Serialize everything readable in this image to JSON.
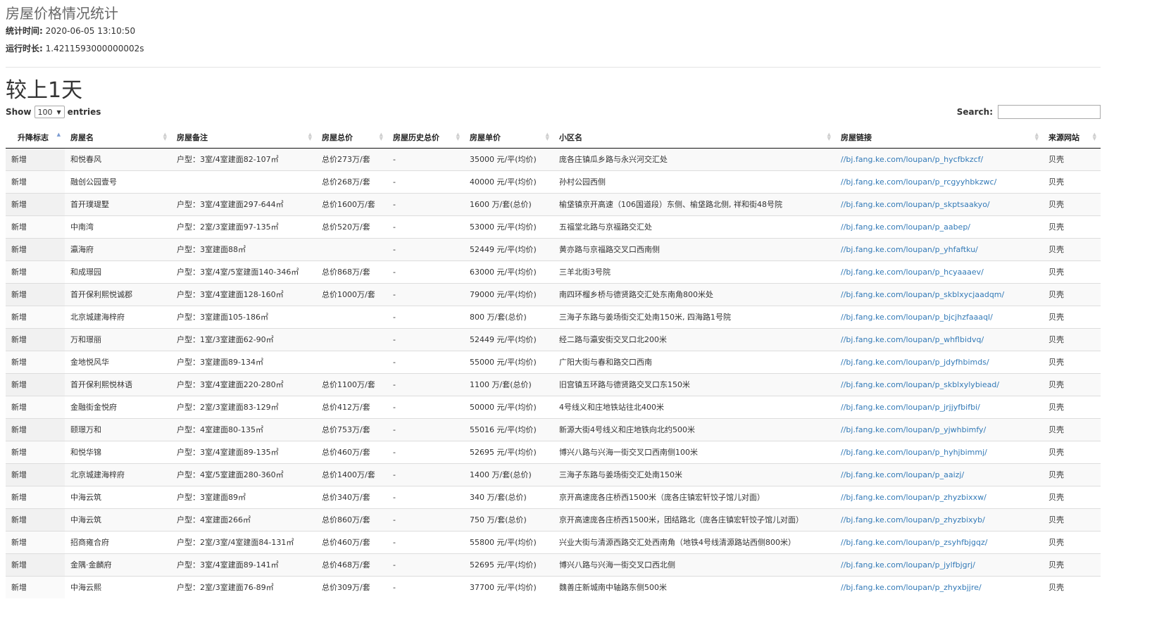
{
  "header": {
    "title": "房屋价格情况统计",
    "stat_time_label": "统计时间:",
    "stat_time_value": "2020-06-05 13:10:50",
    "run_time_label": "运行时长:",
    "run_time_value": "1.4211593000000002s"
  },
  "section": {
    "title": "较上1天"
  },
  "controls": {
    "show_label": "Show",
    "page_size": "100",
    "entries_label": "entries",
    "search_label": "Search:",
    "search_value": ""
  },
  "table": {
    "sorted_column": 0,
    "sort_direction": "asc",
    "columns": [
      "升降标志",
      "房屋名",
      "房屋备注",
      "房屋总价",
      "房屋历史总价",
      "房屋单价",
      "小区名",
      "房屋链接",
      "来源网站"
    ],
    "rows": [
      [
        "新增",
        "和悦春风",
        "户型：3室/4室建面82-107㎡",
        "总价273万/套",
        "-",
        "35000 元/平(均价)",
        "庞各庄镇瓜乡路与永兴河交汇处",
        "//bj.fang.ke.com/loupan/p_hycfbkzcf/",
        "贝壳"
      ],
      [
        "新增",
        "融创公园壹号",
        "",
        "总价268万/套",
        "-",
        "40000 元/平(均价)",
        "孙村公园西侧",
        "//bj.fang.ke.com/loupan/p_rcgyyhbkzwc/",
        "贝壳"
      ],
      [
        "新增",
        "首开璞瑅墅",
        "户型：3室/4室建面297-644㎡",
        "总价1600万/套",
        "-",
        "1600 万/套(总价)",
        "榆垡镇京开高速（106国道段）东侧、榆垡路北侧, 祥和街48号院",
        "//bj.fang.ke.com/loupan/p_skptsaakyo/",
        "贝壳"
      ],
      [
        "新增",
        "中南湾",
        "户型：2室/3室建面97-135㎡",
        "总价520万/套",
        "-",
        "53000 元/平(均价)",
        "五福堂北路与京福路交汇处",
        "//bj.fang.ke.com/loupan/p_aabep/",
        "贝壳"
      ],
      [
        "新增",
        "瀛海府",
        "户型：3室建面88㎡",
        "",
        "-",
        "52449 元/平(均价)",
        "黄亦路与京福路交叉口西南侧",
        "//bj.fang.ke.com/loupan/p_yhfaftku/",
        "贝壳"
      ],
      [
        "新增",
        "和成璟园",
        "户型：3室/4室/5室建面140-346㎡",
        "总价868万/套",
        "-",
        "63000 元/平(均价)",
        "三羊北街3号院",
        "//bj.fang.ke.com/loupan/p_hcyaaaev/",
        "贝壳"
      ],
      [
        "新增",
        "首开保利熙悦诚郡",
        "户型：3室/4室建面128-160㎡",
        "总价1000万/套",
        "-",
        "79000 元/平(均价)",
        "南四环榴乡桥与德贤路交汇处东南角800米处",
        "//bj.fang.ke.com/loupan/p_skblxycjaadqm/",
        "贝壳"
      ],
      [
        "新增",
        "北京城建海梓府",
        "户型：3室建面105-186㎡",
        "",
        "-",
        "800 万/套(总价)",
        "三海子东路与姜场街交汇处南150米, 四海路1号院",
        "//bj.fang.ke.com/loupan/p_bjcjhzfaaaql/",
        "贝壳"
      ],
      [
        "新增",
        "万和璟丽",
        "户型：1室/3室建面62-90㎡",
        "",
        "-",
        "52449 元/平(均价)",
        "经二路与瀛安街交叉口北200米",
        "//bj.fang.ke.com/loupan/p_whflbidvq/",
        "贝壳"
      ],
      [
        "新增",
        "金地悦风华",
        "户型：3室建面89-134㎡",
        "",
        "-",
        "55000 元/平(均价)",
        "广阳大街与春和路交口西南",
        "//bj.fang.ke.com/loupan/p_jdyfhbimds/",
        "贝壳"
      ],
      [
        "新增",
        "首开保利熙悦林语",
        "户型：3室/4室建面220-280㎡",
        "总价1100万/套",
        "-",
        "1100 万/套(总价)",
        "旧宫镇五环路与德贤路交叉口东150米",
        "//bj.fang.ke.com/loupan/p_skblxylybiead/",
        "贝壳"
      ],
      [
        "新增",
        "金融街金悦府",
        "户型：2室/3室建面83-129㎡",
        "总价412万/套",
        "-",
        "50000 元/平(均价)",
        "4号线义和庄地铁站往北400米",
        "//bj.fang.ke.com/loupan/p_jrjjyfbifbi/",
        "贝壳"
      ],
      [
        "新增",
        "颐璟万和",
        "户型：4室建面80-135㎡",
        "总价753万/套",
        "-",
        "55016 元/平(均价)",
        "新源大街4号线义和庄地铁向北约500米",
        "//bj.fang.ke.com/loupan/p_yjwhbimfy/",
        "贝壳"
      ],
      [
        "新增",
        "和悦华锦",
        "户型：3室/4室建面89-135㎡",
        "总价460万/套",
        "-",
        "52695 元/平(均价)",
        "博兴八路与兴海一街交叉口西南侧100米",
        "//bj.fang.ke.com/loupan/p_hyhjbimmj/",
        "贝壳"
      ],
      [
        "新增",
        "北京城建海梓府",
        "户型：4室/5室建面280-360㎡",
        "总价1400万/套",
        "-",
        "1400 万/套(总价)",
        "三海子东路与姜场街交汇处南150米",
        "//bj.fang.ke.com/loupan/p_aaizj/",
        "贝壳"
      ],
      [
        "新增",
        "中海云筑",
        "户型：3室建面89㎡",
        "总价340万/套",
        "-",
        "340 万/套(总价)",
        "京开高速庞各庄桥西1500米（庞各庄镇宏轩饺子馆儿对面）",
        "//bj.fang.ke.com/loupan/p_zhyzbixxw/",
        "贝壳"
      ],
      [
        "新增",
        "中海云筑",
        "户型：4室建面266㎡",
        "总价860万/套",
        "-",
        "750 万/套(总价)",
        "京开高速庞各庄桥西1500米，团结路北（庞各庄镇宏轩饺子馆儿对面）",
        "//bj.fang.ke.com/loupan/p_zhyzbixyb/",
        "贝壳"
      ],
      [
        "新增",
        "招商雍合府",
        "户型：2室/3室/4室建面84-131㎡",
        "总价460万/套",
        "-",
        "55800 元/平(均价)",
        "兴业大街与清源西路交汇处西南角（地铁4号线清源路站西侧800米）",
        "//bj.fang.ke.com/loupan/p_zsyhfbjgqz/",
        "贝壳"
      ],
      [
        "新增",
        "金隅·金麟府",
        "户型：3室/4室建面89-141㎡",
        "总价468万/套",
        "-",
        "52695 元/平(均价)",
        "博兴八路与兴海一街交叉口西北侧",
        "//bj.fang.ke.com/loupan/p_jylfbjgrj/",
        "贝壳"
      ],
      [
        "新增",
        "中海云熙",
        "户型：2室/3室建面76-89㎡",
        "总价309万/套",
        "-",
        "37700 元/平(均价)",
        "魏善庄新城南中轴路东侧500米",
        "//bj.fang.ke.com/loupan/p_zhyxbjjre/",
        "贝壳"
      ]
    ]
  }
}
